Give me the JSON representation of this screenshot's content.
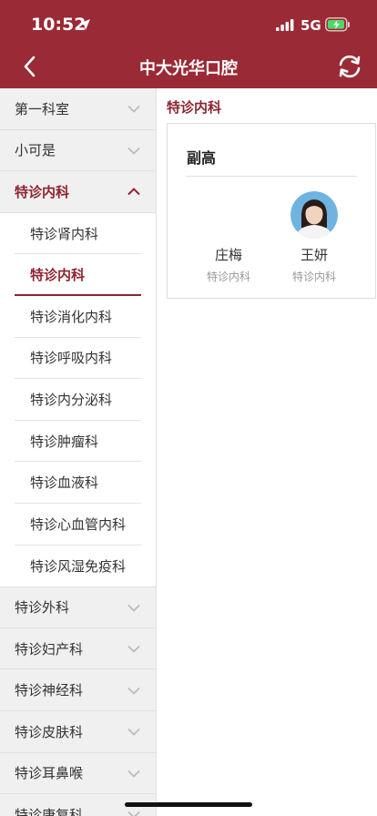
{
  "status_bar": {
    "time": "10:52",
    "network": "5G"
  },
  "nav": {
    "title": "中大光华口腔"
  },
  "sidebar": {
    "categories_top": [
      {
        "label": "第一科室"
      },
      {
        "label": "小可是"
      }
    ],
    "open_category": {
      "label": "特诊内科"
    },
    "sub_items": [
      {
        "label": "特诊肾内科"
      },
      {
        "label": "特诊内科"
      },
      {
        "label": "特诊消化内科"
      },
      {
        "label": "特诊呼吸内科"
      },
      {
        "label": "特诊内分泌科"
      },
      {
        "label": "特诊肿瘤科"
      },
      {
        "label": "特诊血液科"
      },
      {
        "label": "特诊心血管内科"
      },
      {
        "label": "特诊风湿免疫科"
      }
    ],
    "categories_bottom": [
      {
        "label": "特诊外科"
      },
      {
        "label": "特诊妇产科"
      },
      {
        "label": "特诊神经科"
      },
      {
        "label": "特诊皮肤科"
      },
      {
        "label": "特诊耳鼻喉"
      },
      {
        "label": "特诊康复科"
      }
    ]
  },
  "content": {
    "title": "特诊内科",
    "group": {
      "heading": "副高",
      "doctors": [
        {
          "name": "庄梅",
          "dept": "特诊内科"
        },
        {
          "name": "王妍",
          "dept": "特诊内科"
        }
      ]
    }
  },
  "colors": {
    "brand": "#9a2a35",
    "accent_text": "#8e2530"
  },
  "icons": [
    "location-arrow-icon",
    "signal-icon",
    "battery-charging-icon",
    "back-chevron-icon",
    "refresh-icon",
    "chevron-down-icon",
    "chevron-up-icon"
  ]
}
